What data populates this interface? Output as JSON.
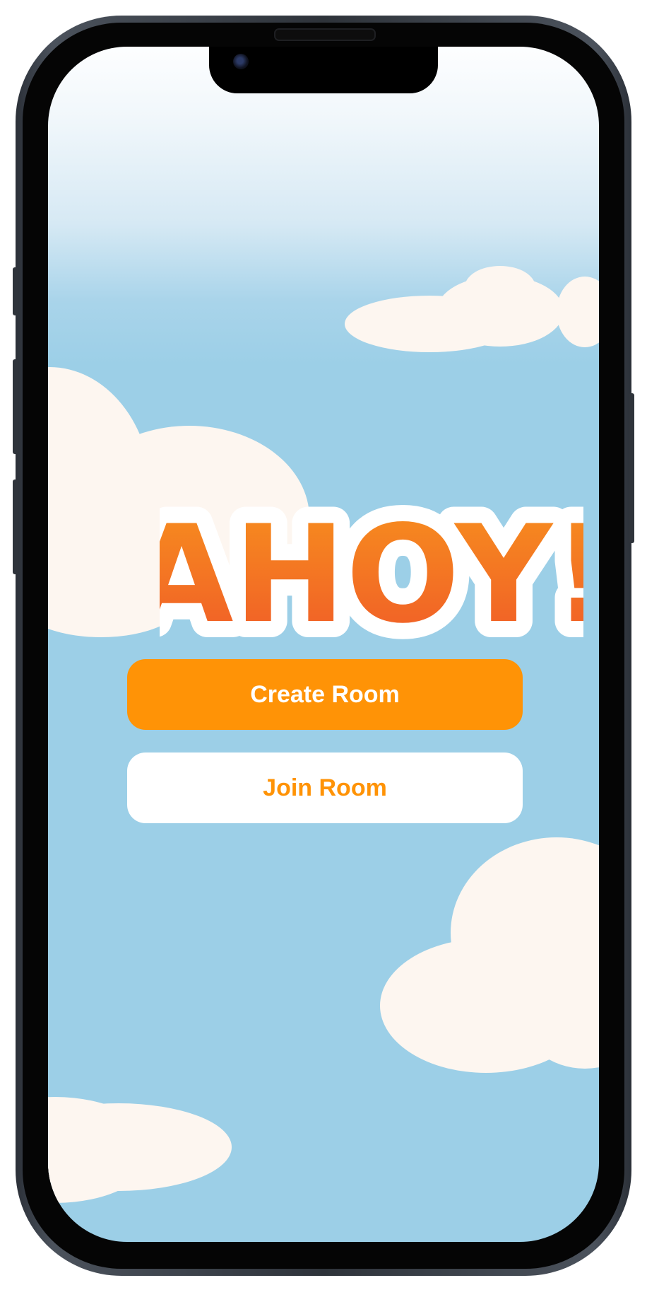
{
  "app": {
    "logo_text": "AHOY!",
    "primary_color": "#ff9306",
    "logo_gradient": [
      "#f7901e",
      "#f05a28"
    ],
    "sky_color": "#9ccfe7",
    "cloud_color": "#fdf6f0"
  },
  "actions": {
    "create_label": "Create Room",
    "join_label": "Join Room"
  }
}
